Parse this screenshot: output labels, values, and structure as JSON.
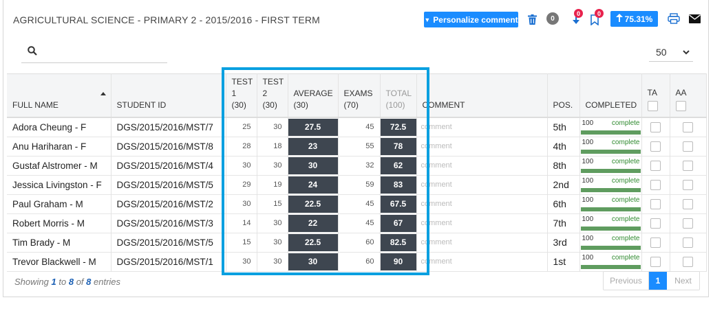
{
  "header": {
    "title": "AGRICULTURAL SCIENCE - PRIMARY 2 - 2015/2016 - FIRST TERM",
    "personalize_label": "Personalize comment",
    "grey_badge": "0",
    "download_badge": "0",
    "bookmark_badge": "0",
    "progress_label": "75.31%"
  },
  "search": {
    "placeholder": ""
  },
  "page_size": {
    "selected": "50"
  },
  "table": {
    "columns": {
      "full_name": "FULL NAME",
      "student_id": "STUDENT ID",
      "test1_a": "TEST",
      "test1_b": "1",
      "test1_c": "(30)",
      "test2_a": "TEST",
      "test2_b": "2",
      "test2_c": "(30)",
      "average_a": "AVERAGE",
      "average_b": "(30)",
      "exams_a": "EXAMS",
      "exams_b": "(70)",
      "total_a": "TOTAL",
      "total_b": "(100)",
      "comment": "COMMENT",
      "pos": "POS.",
      "completed": "COMPLETED",
      "ta": "TA",
      "aa": "AA"
    },
    "rows": [
      {
        "name": "Adora Cheung - F",
        "id": "DGS/2015/2016/MST/7",
        "test1": "25",
        "test2": "30",
        "average": "27.5",
        "exams": "45",
        "total": "72.5",
        "comment": "comment",
        "pos": "5th",
        "completed": "100",
        "completed_word": "complete"
      },
      {
        "name": "Anu Hariharan - F",
        "id": "DGS/2015/2016/MST/8",
        "test1": "28",
        "test2": "18",
        "average": "23",
        "exams": "55",
        "total": "78",
        "comment": "comment",
        "pos": "4th",
        "completed": "100",
        "completed_word": "complete"
      },
      {
        "name": "Gustaf Alstromer - M",
        "id": "DGS/2015/2016/MST/4",
        "test1": "30",
        "test2": "30",
        "average": "30",
        "exams": "32",
        "total": "62",
        "comment": "comment",
        "pos": "8th",
        "completed": "100",
        "completed_word": "complete"
      },
      {
        "name": "Jessica Livingston - F",
        "id": "DGS/2015/2016/MST/5",
        "test1": "29",
        "test2": "19",
        "average": "24",
        "exams": "59",
        "total": "83",
        "comment": "comment",
        "pos": "2nd",
        "completed": "100",
        "completed_word": "complete"
      },
      {
        "name": "Paul Graham - M",
        "id": "DGS/2015/2016/MST/2",
        "test1": "30",
        "test2": "15",
        "average": "22.5",
        "exams": "45",
        "total": "67.5",
        "comment": "comment",
        "pos": "6th",
        "completed": "100",
        "completed_word": "complete"
      },
      {
        "name": "Robert Morris - M",
        "id": "DGS/2015/2016/MST/3",
        "test1": "14",
        "test2": "30",
        "average": "22",
        "exams": "45",
        "total": "67",
        "comment": "comment",
        "pos": "7th",
        "completed": "100",
        "completed_word": "complete"
      },
      {
        "name": "Tim Brady - M",
        "id": "DGS/2015/2016/MST/5",
        "test1": "15",
        "test2": "30",
        "average": "22.5",
        "exams": "60",
        "total": "82.5",
        "comment": "comment",
        "pos": "3rd",
        "completed": "100",
        "completed_word": "complete"
      },
      {
        "name": "Trevor Blackwell - M",
        "id": "DGS/2015/2016/MST/1",
        "test1": "30",
        "test2": "30",
        "average": "30",
        "exams": "60",
        "total": "90",
        "comment": "comment",
        "pos": "1st",
        "completed": "100",
        "completed_word": "complete"
      }
    ]
  },
  "footer": {
    "showing": "Showing",
    "from": "1",
    "to_word": "to",
    "to": "8",
    "of_word": "of",
    "total": "8",
    "entries": "entries",
    "prev_label": "Previous",
    "current_page": "1",
    "next_label": "Next"
  },
  "colors": {
    "accent": "#1a8cff",
    "badge_red": "#e8224d",
    "dark_cell": "#3e4650",
    "progress_green": "#5f9c5f",
    "highlight": "#0aa0e0"
  },
  "icons": [
    "trash-icon",
    "download-icon",
    "bookmark-icon",
    "arrow-up-icon",
    "print-icon",
    "mail-icon",
    "search-icon",
    "chevron-down-icon",
    "caret-down-icon",
    "sort-up-icon"
  ]
}
